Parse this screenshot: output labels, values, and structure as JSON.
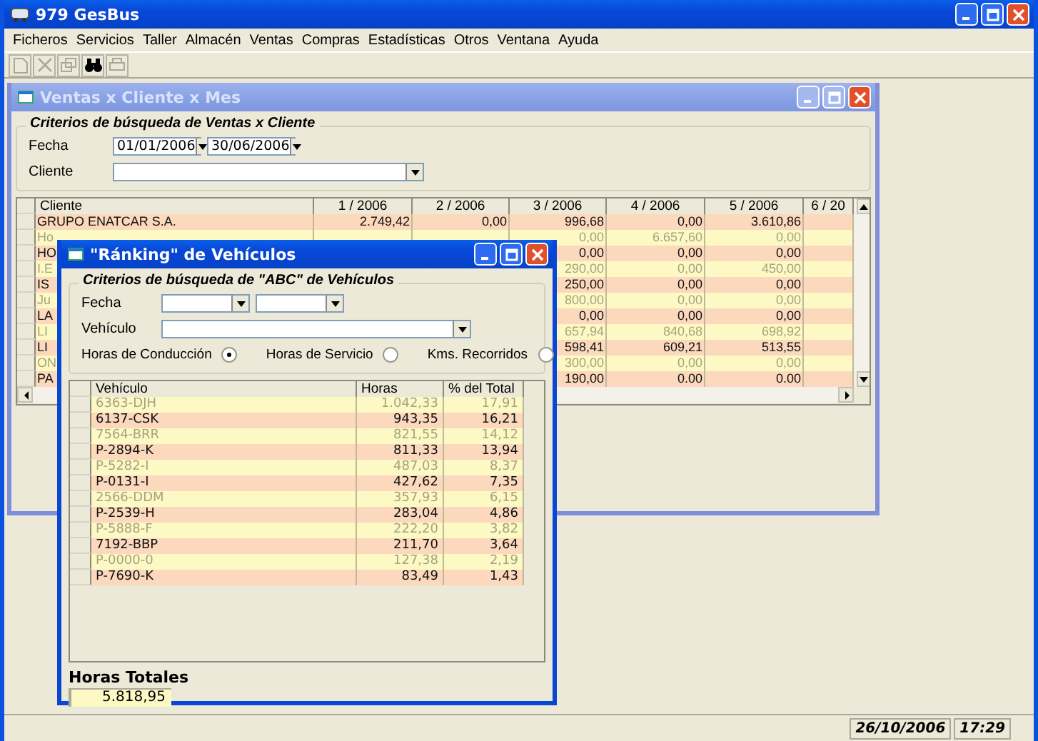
{
  "app": {
    "title": "979 GesBus"
  },
  "menu": [
    "Ficheros",
    "Servicios",
    "Taller",
    "Almacén",
    "Ventas",
    "Compras",
    "Estadísticas",
    "Otros",
    "Ventana",
    "Ayuda"
  ],
  "toolbar": [
    {
      "kind": "new",
      "disabled": true
    },
    {
      "kind": "delete",
      "disabled": true
    },
    {
      "kind": "window",
      "disabled": true
    },
    {
      "kind": "find",
      "disabled": false
    },
    {
      "kind": "print",
      "disabled": true
    }
  ],
  "sales_window": {
    "title": "Ventas x Cliente x Mes",
    "active": false,
    "criteria": {
      "title": "Criterios de búsqueda de Ventas x Cliente",
      "date_label": "Fecha",
      "date_from": "01/01/2006",
      "date_to": "30/06/2006",
      "client_label": "Cliente"
    },
    "grid": {
      "columns": [
        "Cliente",
        "1 / 2006",
        "2 / 2006",
        "3 / 2006",
        "4 / 2006",
        "5 / 2006",
        "6 / 20"
      ],
      "rows": [
        {
          "kind": "bold",
          "client": "GRUPO ENATCAR S.A.",
          "m1": "2.749,42",
          "m2": "0,00",
          "m3": "996,68",
          "m4": "0,00",
          "m5": "3.610,86"
        },
        {
          "kind": "dim",
          "client": "Ho",
          "m3": "0,00",
          "m4": "6.657,60",
          "m5": "0,00"
        },
        {
          "kind": "bold",
          "client": "HO",
          "m3": "0,00",
          "m4": "0,00",
          "m5": "0,00"
        },
        {
          "kind": "dim",
          "client": "I.E",
          "m3": "290,00",
          "m4": "0,00",
          "m5": "450,00"
        },
        {
          "kind": "bold",
          "client": "IS",
          "m3": "250,00",
          "m4": "0,00",
          "m5": "0,00"
        },
        {
          "kind": "dim",
          "client": "Ju",
          "m3": "800,00",
          "m4": "0,00",
          "m5": "0,00"
        },
        {
          "kind": "bold",
          "client": "LA",
          "m3": "0,00",
          "m4": "0,00",
          "m5": "0,00"
        },
        {
          "kind": "dim",
          "client": "LI",
          "m3": "657,94",
          "m4": "840,68",
          "m5": "698,92"
        },
        {
          "kind": "bold",
          "client": "LI",
          "m3": "598,41",
          "m4": "609,21",
          "m5": "513,55"
        },
        {
          "kind": "dim",
          "client": "ON",
          "m3": "300,00",
          "m4": "0,00",
          "m5": "0,00"
        },
        {
          "kind": "bold",
          "client": "PA",
          "m3": "190,00",
          "m4": "0.00",
          "m5": "0.00"
        }
      ]
    }
  },
  "ranking_window": {
    "title": "\"Ránking\" de Vehículos",
    "active": true,
    "criteria": {
      "title": "Criterios de búsqueda de \"ABC\" de Vehículos",
      "date_label": "Fecha",
      "vehicle_label": "Vehículo",
      "options": [
        {
          "label": "Horas de Conducción",
          "selected": true
        },
        {
          "label": "Horas de Servicio",
          "selected": false
        },
        {
          "label": "Kms. Recorridos",
          "selected": false
        }
      ]
    },
    "grid": {
      "columns": [
        "Vehículo",
        "Horas",
        "% del Total"
      ],
      "rows": [
        {
          "kind": "dim",
          "vehicle": "6363-DJH",
          "hours": "1.042,33",
          "share": "17,91"
        },
        {
          "kind": "bold",
          "vehicle": "6137-CSK",
          "hours": "943,35",
          "share": "16,21"
        },
        {
          "kind": "dim",
          "vehicle": "7564-BRR",
          "hours": "821,55",
          "share": "14,12"
        },
        {
          "kind": "bold",
          "vehicle": "P-2894-K",
          "hours": "811,33",
          "share": "13,94"
        },
        {
          "kind": "dim",
          "vehicle": "P-5282-I",
          "hours": "487,03",
          "share": "8,37"
        },
        {
          "kind": "bold",
          "vehicle": "P-0131-I",
          "hours": "427,62",
          "share": "7,35"
        },
        {
          "kind": "dim",
          "vehicle": "2566-DDM",
          "hours": "357,93",
          "share": "6,15"
        },
        {
          "kind": "bold",
          "vehicle": "P-2539-H",
          "hours": "283,04",
          "share": "4,86"
        },
        {
          "kind": "dim",
          "vehicle": "P-5888-F",
          "hours": "222,20",
          "share": "3,82"
        },
        {
          "kind": "bold",
          "vehicle": "7192-BBP",
          "hours": "211,70",
          "share": "3,64"
        },
        {
          "kind": "dim",
          "vehicle": "P-0000-0",
          "hours": "127,38",
          "share": "2,19"
        },
        {
          "kind": "bold",
          "vehicle": "P-7690-K",
          "hours": "83,49",
          "share": "1,43"
        }
      ]
    },
    "total_label": "Horas Totales",
    "total": "5.818,95"
  },
  "status_bar": {
    "date": "26/10/2006",
    "time": "17:29"
  }
}
